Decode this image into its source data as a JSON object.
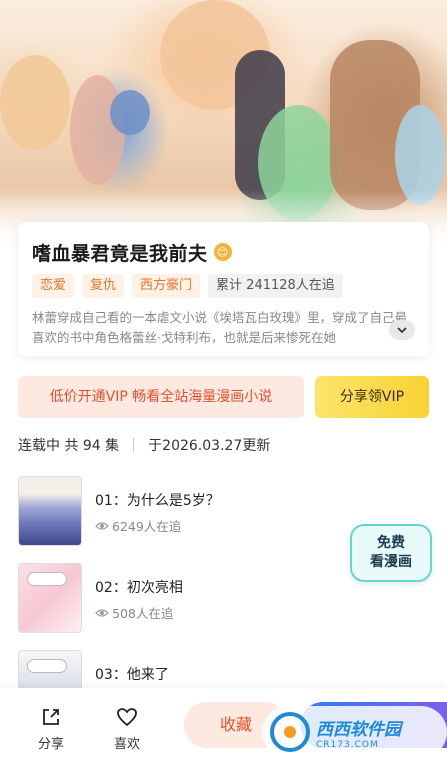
{
  "comic": {
    "title": "嗜血暴君竟是我前夫",
    "title_badge": "😊",
    "tags": [
      "恋爱",
      "复仇",
      "西方豪门"
    ],
    "follow_stat": "累计 241128人在追",
    "description": "林蕾穿成自己看的一本虐文小说《埃塔瓦白玫瑰》里，穿成了自己最喜欢的书中角色格蕾丝·戈特利布，也就是后来惨死在她"
  },
  "promo": {
    "vip_banner": "低价开通VIP 畅看全站海量漫画小说",
    "share_vip": "分享领VIP"
  },
  "episodes_header": {
    "status": "连载中 共 94 集",
    "updated": "于2026.03.27更新"
  },
  "episodes": [
    {
      "title": "01：为什么是5岁？",
      "views": "6249人在追"
    },
    {
      "title": "02：初次亮相",
      "views": "508人在追"
    },
    {
      "title": "03：他来了",
      "views": ""
    }
  ],
  "free_badge": {
    "line1": "免费",
    "line2": "看漫画"
  },
  "bottom_bar": {
    "share_label": "分享",
    "like_label": "喜欢",
    "collect_label": "收藏"
  },
  "watermark": {
    "main": "西西软件园",
    "sub": "CR173.COM"
  },
  "colors": {
    "accent_orange": "#e7752b",
    "vip_red": "#e2512f",
    "vip_yellow": "#f8d334",
    "read_blue": "#2f7df6",
    "free_teal": "#5fd9cc"
  }
}
